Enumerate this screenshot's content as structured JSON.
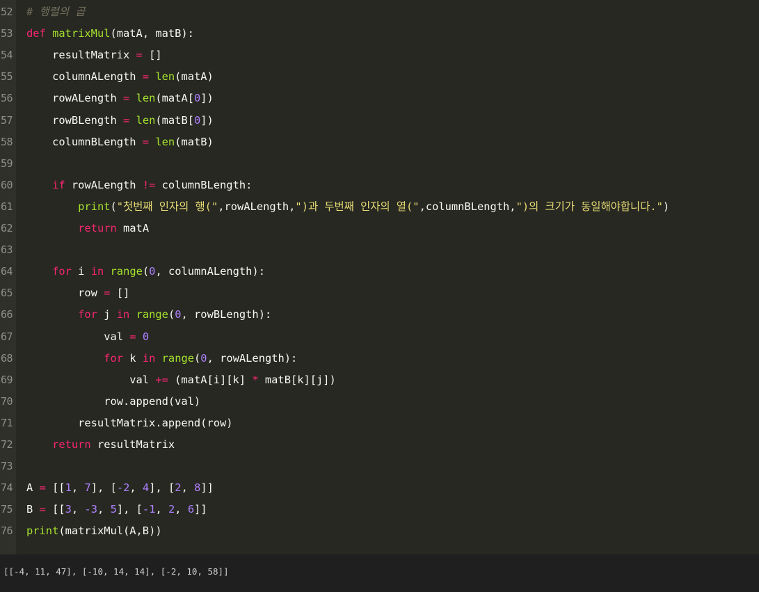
{
  "editor": {
    "lines": [
      {
        "n": "52",
        "tokens": [
          {
            "t": "# 행렬의 곱",
            "c": "cm"
          }
        ]
      },
      {
        "n": "53",
        "tokens": [
          {
            "t": "def ",
            "c": "kw"
          },
          {
            "t": "matrixMul",
            "c": "fn"
          },
          {
            "t": "(matA, matB):",
            "c": ""
          }
        ]
      },
      {
        "n": "54",
        "tokens": [
          {
            "t": "    resultMatrix ",
            "c": ""
          },
          {
            "t": "=",
            "c": "op"
          },
          {
            "t": " []",
            "c": ""
          }
        ]
      },
      {
        "n": "55",
        "tokens": [
          {
            "t": "    columnALength ",
            "c": ""
          },
          {
            "t": "=",
            "c": "op"
          },
          {
            "t": " ",
            "c": ""
          },
          {
            "t": "len",
            "c": "bi"
          },
          {
            "t": "(matA)",
            "c": ""
          }
        ]
      },
      {
        "n": "56",
        "tokens": [
          {
            "t": "    rowALength ",
            "c": ""
          },
          {
            "t": "=",
            "c": "op"
          },
          {
            "t": " ",
            "c": ""
          },
          {
            "t": "len",
            "c": "bi"
          },
          {
            "t": "(matA[",
            "c": ""
          },
          {
            "t": "0",
            "c": "num"
          },
          {
            "t": "])",
            "c": ""
          }
        ]
      },
      {
        "n": "57",
        "tokens": [
          {
            "t": "    rowBLength ",
            "c": ""
          },
          {
            "t": "=",
            "c": "op"
          },
          {
            "t": " ",
            "c": ""
          },
          {
            "t": "len",
            "c": "bi"
          },
          {
            "t": "(matB[",
            "c": ""
          },
          {
            "t": "0",
            "c": "num"
          },
          {
            "t": "])",
            "c": ""
          }
        ]
      },
      {
        "n": "58",
        "tokens": [
          {
            "t": "    columnBLength ",
            "c": ""
          },
          {
            "t": "=",
            "c": "op"
          },
          {
            "t": " ",
            "c": ""
          },
          {
            "t": "len",
            "c": "bi"
          },
          {
            "t": "(matB)",
            "c": ""
          }
        ]
      },
      {
        "n": "59",
        "tokens": []
      },
      {
        "n": "60",
        "tokens": [
          {
            "t": "    ",
            "c": ""
          },
          {
            "t": "if",
            "c": "kw"
          },
          {
            "t": " rowALength ",
            "c": ""
          },
          {
            "t": "!=",
            "c": "op"
          },
          {
            "t": " columnBLength:",
            "c": ""
          }
        ]
      },
      {
        "n": "61",
        "tokens": [
          {
            "t": "        ",
            "c": ""
          },
          {
            "t": "print",
            "c": "bi"
          },
          {
            "t": "(",
            "c": ""
          },
          {
            "t": "\"첫번째 인자의 행(\"",
            "c": "str"
          },
          {
            "t": ",rowALength,",
            "c": ""
          },
          {
            "t": "\")과 두번째 인자의 열(\"",
            "c": "str"
          },
          {
            "t": ",columnBLength,",
            "c": ""
          },
          {
            "t": "\")의 크기가 동일해야합니다.\"",
            "c": "str"
          },
          {
            "t": ")",
            "c": ""
          }
        ]
      },
      {
        "n": "62",
        "tokens": [
          {
            "t": "        ",
            "c": ""
          },
          {
            "t": "return",
            "c": "kw"
          },
          {
            "t": " matA",
            "c": ""
          }
        ]
      },
      {
        "n": "63",
        "tokens": []
      },
      {
        "n": "64",
        "tokens": [
          {
            "t": "    ",
            "c": ""
          },
          {
            "t": "for",
            "c": "kw"
          },
          {
            "t": " i ",
            "c": ""
          },
          {
            "t": "in",
            "c": "kw"
          },
          {
            "t": " ",
            "c": ""
          },
          {
            "t": "range",
            "c": "bi"
          },
          {
            "t": "(",
            "c": ""
          },
          {
            "t": "0",
            "c": "num"
          },
          {
            "t": ", columnALength):",
            "c": ""
          }
        ]
      },
      {
        "n": "65",
        "tokens": [
          {
            "t": "        row ",
            "c": ""
          },
          {
            "t": "=",
            "c": "op"
          },
          {
            "t": " []",
            "c": ""
          }
        ]
      },
      {
        "n": "66",
        "tokens": [
          {
            "t": "        ",
            "c": ""
          },
          {
            "t": "for",
            "c": "kw"
          },
          {
            "t": " j ",
            "c": ""
          },
          {
            "t": "in",
            "c": "kw"
          },
          {
            "t": " ",
            "c": ""
          },
          {
            "t": "range",
            "c": "bi"
          },
          {
            "t": "(",
            "c": ""
          },
          {
            "t": "0",
            "c": "num"
          },
          {
            "t": ", rowBLength):",
            "c": ""
          }
        ]
      },
      {
        "n": "67",
        "tokens": [
          {
            "t": "            val ",
            "c": ""
          },
          {
            "t": "=",
            "c": "op"
          },
          {
            "t": " ",
            "c": ""
          },
          {
            "t": "0",
            "c": "num"
          }
        ]
      },
      {
        "n": "68",
        "tokens": [
          {
            "t": "            ",
            "c": ""
          },
          {
            "t": "for",
            "c": "kw"
          },
          {
            "t": " k ",
            "c": ""
          },
          {
            "t": "in",
            "c": "kw"
          },
          {
            "t": " ",
            "c": ""
          },
          {
            "t": "range",
            "c": "bi"
          },
          {
            "t": "(",
            "c": ""
          },
          {
            "t": "0",
            "c": "num"
          },
          {
            "t": ", rowALength):",
            "c": ""
          }
        ]
      },
      {
        "n": "69",
        "tokens": [
          {
            "t": "                val ",
            "c": ""
          },
          {
            "t": "+=",
            "c": "op"
          },
          {
            "t": " (matA[i][k] ",
            "c": ""
          },
          {
            "t": "*",
            "c": "op"
          },
          {
            "t": " matB[k][j])",
            "c": ""
          }
        ]
      },
      {
        "n": "70",
        "tokens": [
          {
            "t": "            row.append(val)",
            "c": ""
          }
        ]
      },
      {
        "n": "71",
        "tokens": [
          {
            "t": "        resultMatrix.append(row)",
            "c": ""
          }
        ]
      },
      {
        "n": "72",
        "tokens": [
          {
            "t": "    ",
            "c": ""
          },
          {
            "t": "return",
            "c": "kw"
          },
          {
            "t": " resultMatrix",
            "c": ""
          }
        ]
      },
      {
        "n": "73",
        "tokens": []
      },
      {
        "n": "74",
        "tokens": [
          {
            "t": "A ",
            "c": ""
          },
          {
            "t": "=",
            "c": "op"
          },
          {
            "t": " [[",
            "c": ""
          },
          {
            "t": "1",
            "c": "num"
          },
          {
            "t": ", ",
            "c": ""
          },
          {
            "t": "7",
            "c": "num"
          },
          {
            "t": "], [",
            "c": ""
          },
          {
            "t": "-2",
            "c": "num"
          },
          {
            "t": ", ",
            "c": ""
          },
          {
            "t": "4",
            "c": "num"
          },
          {
            "t": "], [",
            "c": ""
          },
          {
            "t": "2",
            "c": "num"
          },
          {
            "t": ", ",
            "c": ""
          },
          {
            "t": "8",
            "c": "num"
          },
          {
            "t": "]]",
            "c": ""
          }
        ]
      },
      {
        "n": "75",
        "tokens": [
          {
            "t": "B ",
            "c": ""
          },
          {
            "t": "=",
            "c": "op"
          },
          {
            "t": " [[",
            "c": ""
          },
          {
            "t": "3",
            "c": "num"
          },
          {
            "t": ", ",
            "c": ""
          },
          {
            "t": "-3",
            "c": "num"
          },
          {
            "t": ", ",
            "c": ""
          },
          {
            "t": "5",
            "c": "num"
          },
          {
            "t": "], [",
            "c": ""
          },
          {
            "t": "-1",
            "c": "num"
          },
          {
            "t": ", ",
            "c": ""
          },
          {
            "t": "2",
            "c": "num"
          },
          {
            "t": ", ",
            "c": ""
          },
          {
            "t": "6",
            "c": "num"
          },
          {
            "t": "]]",
            "c": ""
          }
        ]
      },
      {
        "n": "76",
        "tokens": [
          {
            "t": "print",
            "c": "bi"
          },
          {
            "t": "(matrixMul(A,B))",
            "c": ""
          }
        ]
      }
    ]
  },
  "console": {
    "output": "[[-4, 11, 47], [-10, 14, 14], [-2, 10, 58]]"
  },
  "colors": {
    "background": "#272822",
    "gutter": "#2f302a",
    "keyword": "#f92672",
    "function": "#a6e22e",
    "number": "#ae81ff",
    "string": "#e6db74",
    "comment": "#75715e",
    "console_bg": "#1f1f1f"
  }
}
